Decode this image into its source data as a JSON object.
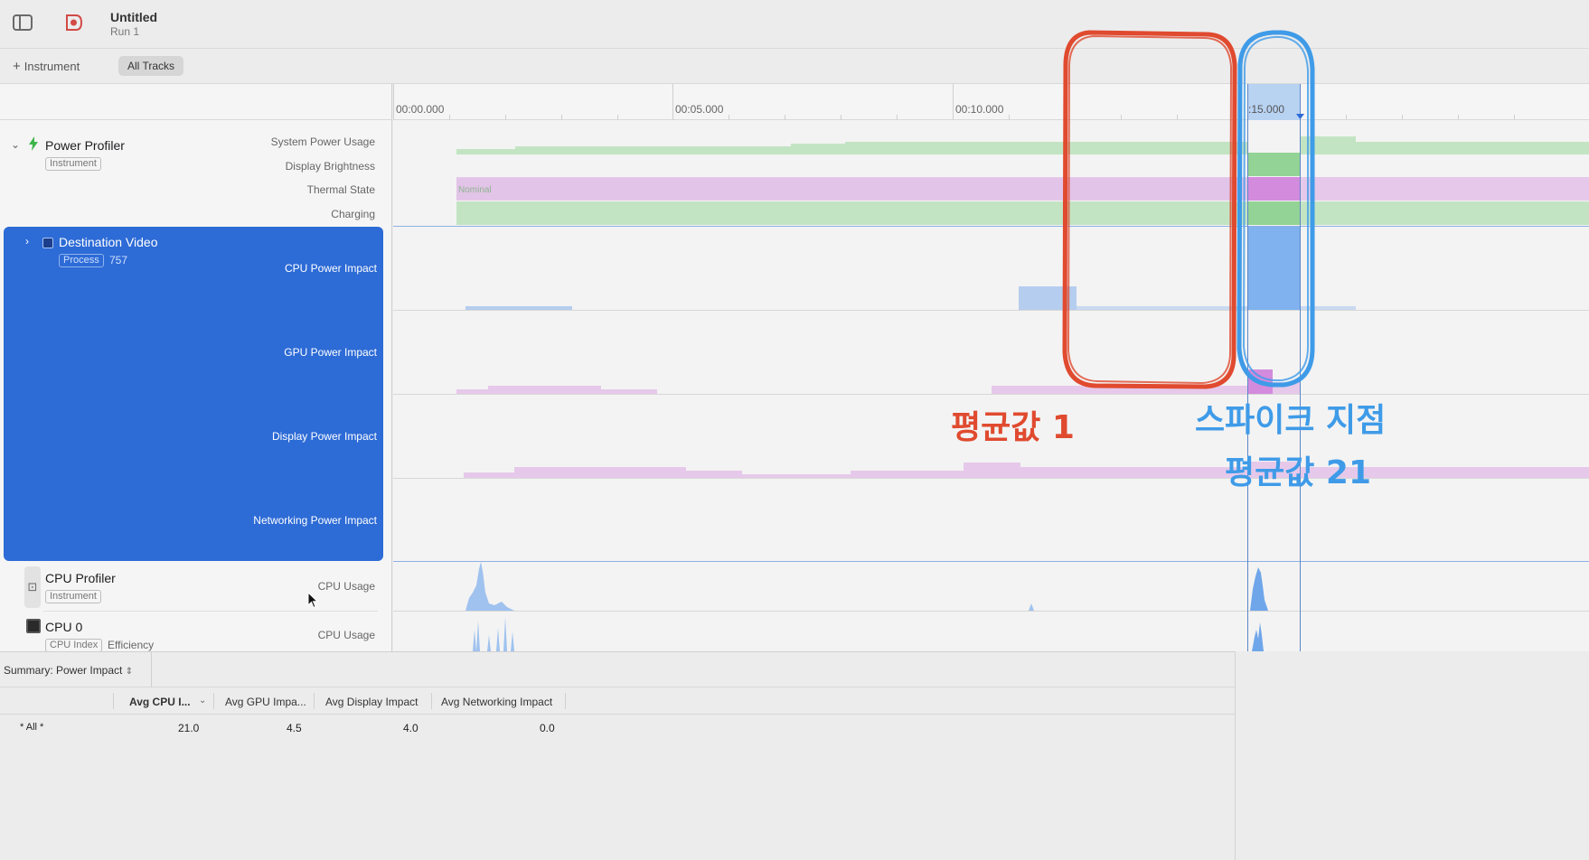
{
  "titlebar": {
    "title": "Untitled",
    "subtitle": "Run 1"
  },
  "toolbar": {
    "add_instrument_label": "Instrument",
    "all_tracks_label": "All Tracks"
  },
  "ruler": {
    "ticks": [
      "00:00.000",
      "00:05.000",
      "00:10.000"
    ],
    "selection_label": ":15.000"
  },
  "tracks": {
    "power_profiler": {
      "name": "Power Profiler",
      "badge": "Instrument",
      "rows": [
        "System Power Usage",
        "Display Brightness",
        "Thermal State",
        "Charging"
      ],
      "thermal_value": "Nominal"
    },
    "destination_video": {
      "name": "Destination Video",
      "badge": "Process",
      "pid": "757",
      "rows": [
        "CPU Power Impact",
        "GPU Power Impact",
        "Display Power Impact",
        "Networking Power Impact"
      ]
    },
    "cpu_profiler": {
      "name": "CPU Profiler",
      "badge": "Instrument",
      "row": "CPU Usage"
    },
    "cpu0": {
      "name": "CPU 0",
      "badge": "CPU Index",
      "core_type": "Efficiency",
      "row": "CPU Usage"
    }
  },
  "summary": {
    "selector_label": "Summary: Power Impact",
    "columns": [
      "Avg CPU I...",
      "Avg GPU Impa...",
      "Avg Display Impact",
      "Avg Networking Impact"
    ],
    "row": {
      "label": "* All *",
      "values": [
        "21.0",
        "4.5",
        "4.0",
        "0.0"
      ]
    }
  },
  "annotations": {
    "red_text": "평균값 1",
    "blue_text_1": "스파이크 지점",
    "blue_text_2": "평균값 21"
  },
  "colors": {
    "selection_blue": "#2d6bd6",
    "power_green": "#b9e0b9",
    "brightness_purple": "#e6c9ea",
    "cpu_blue": "#b5cdee",
    "annotation_red": "#e04a2f",
    "annotation_blue": "#3f9be8"
  }
}
